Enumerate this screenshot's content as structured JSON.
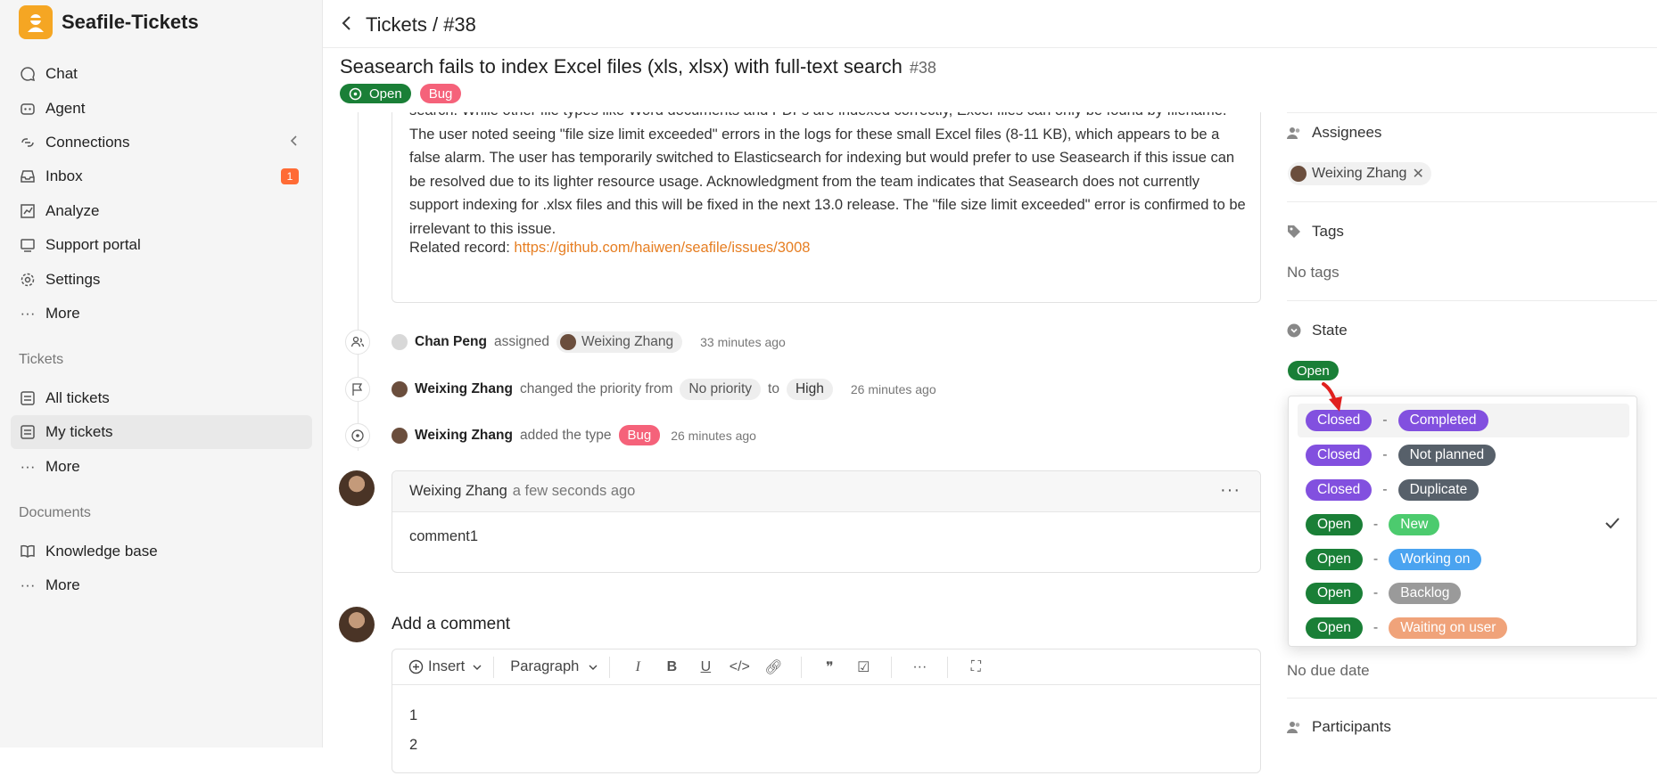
{
  "brand": {
    "name": "Seafile-Tickets"
  },
  "sidebar": {
    "main_items": [
      {
        "label": "Chat",
        "icon": "chat-icon"
      },
      {
        "label": "Agent",
        "icon": "robot-icon"
      },
      {
        "label": "Connections",
        "icon": "connections-icon"
      },
      {
        "label": "Inbox",
        "icon": "inbox-icon",
        "badge": "1"
      },
      {
        "label": "Analyze",
        "icon": "chart-icon"
      },
      {
        "label": "Support portal",
        "icon": "portal-icon"
      },
      {
        "label": "Settings",
        "icon": "gear-icon"
      },
      {
        "label": "More",
        "icon": "more-icon"
      }
    ],
    "tickets_section": "Tickets",
    "tickets_items": [
      {
        "label": "All tickets",
        "icon": "list-icon"
      },
      {
        "label": "My tickets",
        "icon": "list-icon",
        "active": true
      },
      {
        "label": "More",
        "icon": "more-icon"
      }
    ],
    "documents_section": "Documents",
    "documents_items": [
      {
        "label": "Knowledge base",
        "icon": "book-icon"
      },
      {
        "label": "More",
        "icon": "more-icon"
      }
    ]
  },
  "header": {
    "breadcrumb": "Tickets / #38",
    "title": "Seasearch fails to index Excel files (xls, xlsx) with full-text search",
    "number": "#38",
    "status": "Open",
    "type": "Bug"
  },
  "description": {
    "text": "search. While other file types like Word documents and PDFs are indexed correctly, Excel files can only be found by filename. The user noted seeing \"file size limit exceeded\" errors in the logs for these small Excel files (8-11 KB), which appears to be a false alarm. The user has temporarily switched to Elasticsearch for indexing but would prefer to use Seasearch if this issue can be resolved due to its lighter resource usage. Acknowledgment from the team indicates that Seasearch does not currently support indexing for .xlsx files and this will be fixed in the next 13.0 release. The \"file size limit exceeded\" error is confirmed to be irrelevant to this issue.",
    "related_label": "Related record: ",
    "related_link": "https://github.com/haiwen/seafile/issues/3008"
  },
  "timeline": {
    "assign": {
      "who": "Chan Peng",
      "action": "assigned",
      "target": "Weixing Zhang",
      "time": "33 minutes ago"
    },
    "priority": {
      "who": "Weixing Zhang",
      "action": "changed the priority from",
      "from": "No priority",
      "to_word": "to",
      "to": "High",
      "time": "26 minutes ago"
    },
    "type": {
      "who": "Weixing Zhang",
      "action": "added the type",
      "type": "Bug",
      "time": "26 minutes ago"
    }
  },
  "comment": {
    "author": "Weixing Zhang",
    "time": "a few seconds ago",
    "body": "comment1",
    "menu": "···"
  },
  "composer": {
    "title": "Add a comment",
    "insert_label": "Insert",
    "paragraph_label": "Paragraph",
    "line1": "1",
    "line2": "2"
  },
  "right_panel": {
    "assignees_label": "Assignees",
    "assignee": "Weixing Zhang",
    "tags_label": "Tags",
    "tags_value": "No tags",
    "state_label": "State",
    "state_value": "Open",
    "due_value": "No due date",
    "participants_label": "Participants"
  },
  "state_dropdown": {
    "separator": "-",
    "options": [
      {
        "status": "Closed",
        "sub": "Completed",
        "status_color": "#8250df",
        "sub_color": "#8250df"
      },
      {
        "status": "Closed",
        "sub": "Not planned",
        "status_color": "#8250df",
        "sub_color": "#57606a"
      },
      {
        "status": "Closed",
        "sub": "Duplicate",
        "status_color": "#8250df",
        "sub_color": "#57606a"
      },
      {
        "status": "Open",
        "sub": "New",
        "status_color": "#1a7f37",
        "sub_color": "#4ccb6e",
        "selected": true
      },
      {
        "status": "Open",
        "sub": "Working on",
        "status_color": "#1a7f37",
        "sub_color": "#4aa3f0"
      },
      {
        "status": "Open",
        "sub": "Backlog",
        "status_color": "#1a7f37",
        "sub_color": "#9a9a9a"
      },
      {
        "status": "Open",
        "sub": "Waiting on user",
        "status_color": "#1a7f37",
        "sub_color": "#f0a37a"
      }
    ]
  },
  "colors": {
    "accent": "#f5a623",
    "open": "#1a7f37",
    "bug": "#f5627a",
    "link": "#e67e22",
    "annotation_arrow": "#e0201e"
  }
}
